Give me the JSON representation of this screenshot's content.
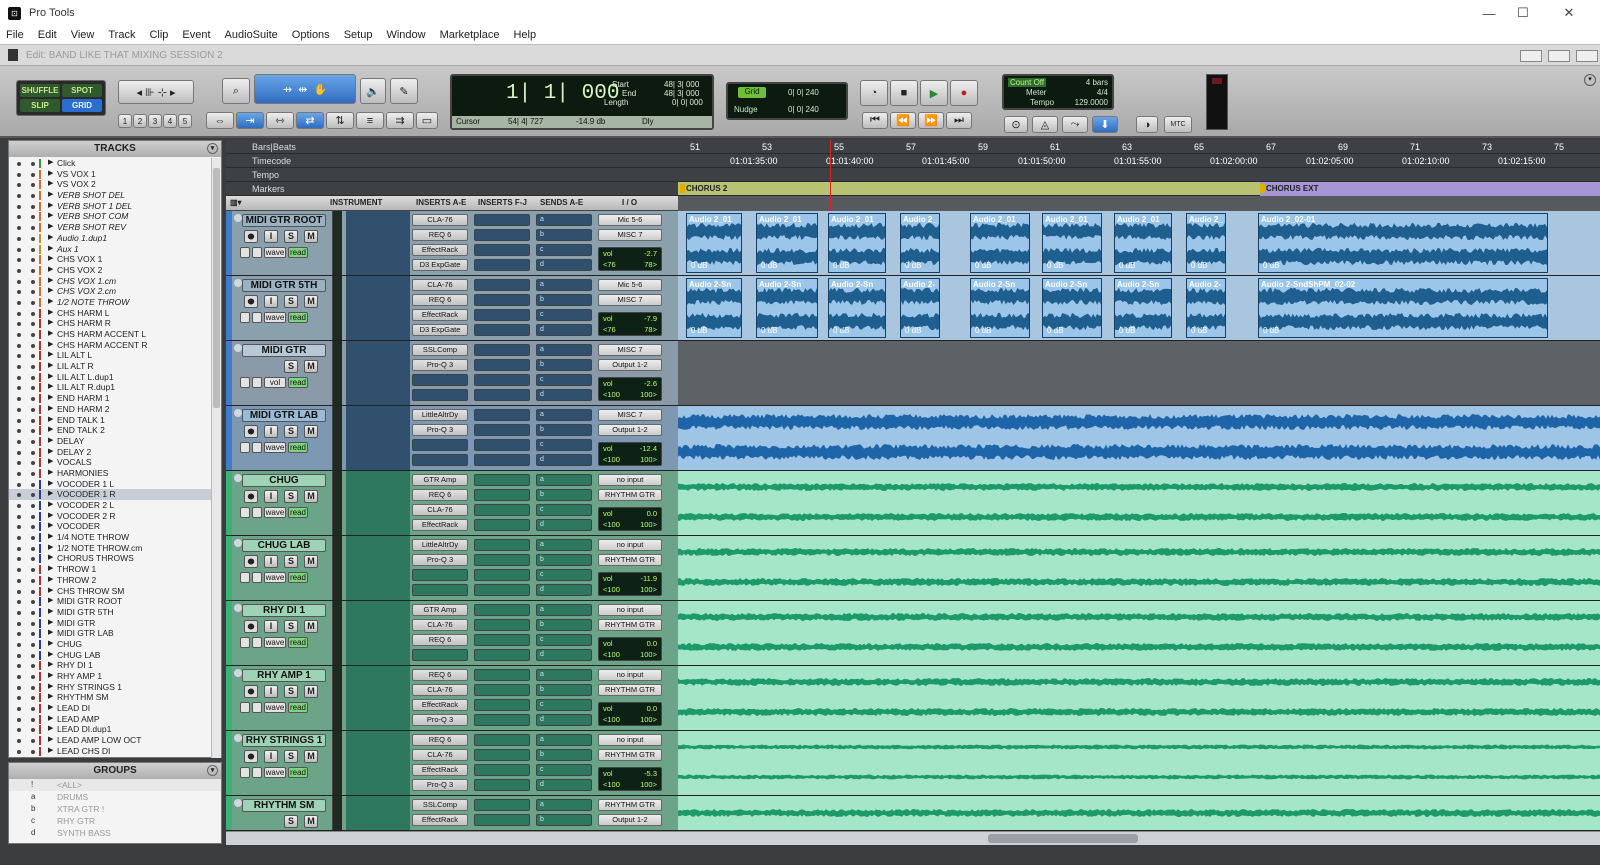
{
  "window": {
    "app_title": "Pro Tools",
    "controls": {
      "minimize": "—",
      "maximize": "☐",
      "close": "✕"
    }
  },
  "menu": [
    "File",
    "Edit",
    "View",
    "Track",
    "Clip",
    "Event",
    "AudioSuite",
    "Options",
    "Setup",
    "Window",
    "Marketplace",
    "Help"
  ],
  "edit_window": {
    "title": "Edit: BAND LIKE THAT MIXING SESSION 2"
  },
  "edit_modes": {
    "shuffle": "SHUFFLE",
    "spot": "SPOT",
    "slip": "SLIP",
    "grid": "GRID",
    "active": "GRID"
  },
  "zoom_presets": [
    "1",
    "2",
    "3",
    "4",
    "5"
  ],
  "counter": {
    "main": "1| 1| 000",
    "start_label": "Start",
    "start": "48| 3| 000",
    "end_label": "End",
    "end": "48| 3| 000",
    "length_label": "Length",
    "length": "0| 0| 000",
    "cursor_label": "Cursor",
    "cursor": "54| 4| 727",
    "cursor_db": "-14.9 db",
    "dly": "Dly"
  },
  "grid_nudge": {
    "grid_label": "Grid",
    "grid_value": "0| 0| 240",
    "nudge_label": "Nudge",
    "nudge_value": "0| 0| 240"
  },
  "midi_controls": {
    "count_off": "Count Off",
    "count_off_value": "4 bars",
    "meter_label": "Meter",
    "meter": "4/4",
    "tempo_label": "Tempo",
    "tempo": "129.0000",
    "mtc": "MTC"
  },
  "tracks_panel": {
    "title": "TRACKS",
    "selected": "VOCODER 1 R",
    "items": [
      {
        "name": "Click",
        "color": "#2d9b3a",
        "italic": false
      },
      {
        "name": "VS VOX 1",
        "color": "#d0702a",
        "italic": false
      },
      {
        "name": "VS VOX 2",
        "color": "#d0702a",
        "italic": false
      },
      {
        "name": "VERB SHOT DEL",
        "color": "#d0702a",
        "italic": true
      },
      {
        "name": "VERB SHOT 1 DEL",
        "color": "#d0702a",
        "italic": true
      },
      {
        "name": "VERB SHOT COM",
        "color": "#d0702a",
        "italic": true
      },
      {
        "name": "VERB SHOT REV",
        "color": "#d0702a",
        "italic": true
      },
      {
        "name": "Audio 1.dup1",
        "color": "#d0902a",
        "italic": true
      },
      {
        "name": "Aux 1",
        "color": "#d0902a",
        "italic": true
      },
      {
        "name": "CHS VOX 1",
        "color": "#d0702a",
        "italic": false
      },
      {
        "name": "CHS VOX 2",
        "color": "#d0702a",
        "italic": false
      },
      {
        "name": "CHS VOX 1.cm",
        "color": "#d0702a",
        "italic": true
      },
      {
        "name": "CHS VOX 2.cm",
        "color": "#d0702a",
        "italic": true
      },
      {
        "name": "1/2 NOTE THROW",
        "color": "#d0702a",
        "italic": true
      },
      {
        "name": "CHS HARM L",
        "color": "#b0342a",
        "italic": false
      },
      {
        "name": "CHS HARM R",
        "color": "#b0342a",
        "italic": false
      },
      {
        "name": "CHS HARM ACCENT L",
        "color": "#b0342a",
        "italic": false
      },
      {
        "name": "CHS HARM ACCENT R",
        "color": "#b0342a",
        "italic": false
      },
      {
        "name": "LIL ALT L",
        "color": "#b0342a",
        "italic": false
      },
      {
        "name": "LIL ALT R",
        "color": "#b0342a",
        "italic": false
      },
      {
        "name": "LIL ALT L.dup1",
        "color": "#b0342a",
        "italic": false
      },
      {
        "name": "LIL ALT R.dup1",
        "color": "#b0342a",
        "italic": false
      },
      {
        "name": "END HARM 1",
        "color": "#b0342a",
        "italic": false
      },
      {
        "name": "END HARM 2",
        "color": "#b0342a",
        "italic": false
      },
      {
        "name": "END TALK 1",
        "color": "#b0342a",
        "italic": false
      },
      {
        "name": "END TALK 2",
        "color": "#b0342a",
        "italic": false
      },
      {
        "name": "DELAY",
        "color": "#b0342a",
        "italic": false
      },
      {
        "name": "DELAY 2",
        "color": "#b0342a",
        "italic": false
      },
      {
        "name": "VOCALS",
        "color": "#b0342a",
        "italic": false
      },
      {
        "name": "HARMONIES",
        "color": "#b0342a",
        "italic": false
      },
      {
        "name": "VOCODER 1 L",
        "color": "#2a3aa0",
        "italic": false
      },
      {
        "name": "VOCODER 1 R",
        "color": "#2a3aa0",
        "italic": false
      },
      {
        "name": "VOCODER 2 L",
        "color": "#2a3aa0",
        "italic": false
      },
      {
        "name": "VOCODER 2 R",
        "color": "#2a3aa0",
        "italic": false
      },
      {
        "name": "VOCODER",
        "color": "#2a3aa0",
        "italic": false
      },
      {
        "name": "1/4 NOTE THROW",
        "color": "#2a3aa0",
        "italic": false
      },
      {
        "name": "1/2 NOTE THROW.cm",
        "color": "#2a3aa0",
        "italic": false
      },
      {
        "name": "CHORUS THROWS",
        "color": "#2a3aa0",
        "italic": false
      },
      {
        "name": "THROW 1",
        "color": "#b0342a",
        "italic": false
      },
      {
        "name": "THROW 2",
        "color": "#b0342a",
        "italic": false
      },
      {
        "name": "CHS THROW SM",
        "color": "#b0342a",
        "italic": false
      },
      {
        "name": "MIDI GTR ROOT",
        "color": "#2a3aa0",
        "italic": false
      },
      {
        "name": "MIDI GTR 5TH",
        "color": "#2a3aa0",
        "italic": false
      },
      {
        "name": "MIDI GTR",
        "color": "#2a3aa0",
        "italic": false
      },
      {
        "name": "MIDI GTR LAB",
        "color": "#2a3aa0",
        "italic": false
      },
      {
        "name": "CHUG",
        "color": "#2a3aa0",
        "italic": false
      },
      {
        "name": "CHUG LAB",
        "color": "#2a3aa0",
        "italic": false
      },
      {
        "name": "RHY DI 1",
        "color": "#b0342a",
        "italic": false
      },
      {
        "name": "RHY AMP 1",
        "color": "#b0342a",
        "italic": false
      },
      {
        "name": "RHY STRINGS 1",
        "color": "#b0342a",
        "italic": false
      },
      {
        "name": "RHYTHM SM",
        "color": "#b0342a",
        "italic": false
      },
      {
        "name": "LEAD DI",
        "color": "#b0342a",
        "italic": false
      },
      {
        "name": "LEAD AMP",
        "color": "#b0342a",
        "italic": false
      },
      {
        "name": "LEAD DI.dup1",
        "color": "#b0342a",
        "italic": false
      },
      {
        "name": "LEAD AMP LOW OCT",
        "color": "#b0342a",
        "italic": false
      },
      {
        "name": "LEAD CHS DI",
        "color": "#b0342a",
        "italic": false
      }
    ]
  },
  "groups_panel": {
    "title": "GROUPS",
    "items": [
      {
        "id": "!",
        "name": "<ALL>"
      },
      {
        "id": "a",
        "name": "DRUMS"
      },
      {
        "id": "b",
        "name": "XTRA GTR !"
      },
      {
        "id": "c",
        "name": "RHY GTR"
      },
      {
        "id": "d",
        "name": "SYNTH BASS"
      }
    ]
  },
  "rulers": {
    "bars_beats_label": "Bars|Beats",
    "timecode_label": "Timecode",
    "tempo_label": "Tempo",
    "markers_label": "Markers",
    "bars": [
      "51",
      "53",
      "55",
      "57",
      "59",
      "61",
      "63",
      "65",
      "67",
      "69",
      "71",
      "73",
      "75"
    ],
    "timecodes": [
      "01:01:35:00",
      "01:01:40:00",
      "01:01:45:00",
      "01:01:50:00",
      "01:01:55:00",
      "01:02:00:00",
      "01:02:05:00",
      "01:02:10:00",
      "01:02:15:00"
    ],
    "markers": [
      "CHORUS 2",
      "CHORUS EXT"
    ]
  },
  "columns": {
    "instrument": "INSTRUMENT",
    "inserts_ae": "INSERTS A-E",
    "inserts_fj": "INSERTS F-J",
    "sends_ae": "SENDS A-E",
    "io": "I / O"
  },
  "send_letters": [
    "a",
    "b",
    "c",
    "d"
  ],
  "track_buttons": {
    "rec": "",
    "input": "I",
    "solo": "S",
    "mute": "M",
    "wave": "wave",
    "read": "read",
    "vol": "vol"
  },
  "tracks": [
    {
      "name": "MIDI GTR ROOT",
      "kind": "midi-audio",
      "inserts": [
        "CLA-76",
        "REQ 6",
        "EffectRack",
        "D3 ExpGate"
      ],
      "io_in": "Mic 5-6",
      "io_out": "MISC 7",
      "vol": "-2.7",
      "pan_l": "<76",
      "pan_r": "78>",
      "clips": [
        "Audio 2_01",
        "Audio 2_01",
        "Audio 2_01",
        "Audio 2_",
        "Audio 2_01",
        "Audio 2_01",
        "Audio 2_01",
        "Audio 2_",
        "Audio 2_02-01"
      ],
      "gain": "0 dB"
    },
    {
      "name": "MIDI GTR 5TH",
      "kind": "midi-audio",
      "inserts": [
        "CLA-76",
        "REQ 6",
        "EffectRack",
        "D3 ExpGate"
      ],
      "io_in": "Mic 5-6",
      "io_out": "MISC 7",
      "vol": "-7.9",
      "pan_l": "<76",
      "pan_r": "78>",
      "clips": [
        "Audio 2-Sn",
        "Audio 2-Sn",
        "Audio 2-Sn",
        "Audio 2-",
        "Audio 2-Sn",
        "Audio 2-Sn",
        "Audio 2-Sn",
        "Audio 2-",
        "Audio 2-SndShPM_02-02"
      ],
      "gain": "0 dB"
    },
    {
      "name": "MIDI GTR",
      "kind": "empty",
      "inserts": [
        "SSLComp",
        "Pro-Q 3"
      ],
      "io_in": "MISC 7",
      "io_out": "Output 1-2",
      "vol": "-2.6",
      "pan_l": "<100",
      "pan_r": "100>"
    },
    {
      "name": "MIDI GTR LAB",
      "kind": "blue",
      "inserts": [
        "LittleAltrDy",
        "Pro-Q 3"
      ],
      "io_in": "MISC 7",
      "io_out": "Output 1-2",
      "vol": "-12.4",
      "pan_l": "<100",
      "pan_r": "100>"
    },
    {
      "name": "CHUG",
      "kind": "green",
      "inserts": [
        "GTR Amp",
        "REQ 6",
        "CLA-76",
        "EffectRack"
      ],
      "io_in": "no input",
      "io_out": "RHYTHM GTR",
      "vol": "0.0",
      "pan_l": "<100",
      "pan_r": "100>"
    },
    {
      "name": "CHUG LAB",
      "kind": "green",
      "inserts": [
        "LittleAltrDy",
        "Pro-Q 3"
      ],
      "io_in": "no input",
      "io_out": "RHYTHM GTR",
      "vol": "-11.9",
      "pan_l": "<100",
      "pan_r": "100>"
    },
    {
      "name": "RHY DI 1",
      "kind": "green",
      "inserts": [
        "GTR Amp",
        "CLA-76",
        "REQ 6"
      ],
      "io_in": "no input",
      "io_out": "RHYTHM GTR",
      "vol": "0.0",
      "pan_l": "<100",
      "pan_r": "100>"
    },
    {
      "name": "RHY AMP 1",
      "kind": "green",
      "inserts": [
        "REQ 6",
        "CLA-76",
        "EffectRack",
        "Pro-Q 3"
      ],
      "io_in": "no input",
      "io_out": "RHYTHM GTR",
      "vol": "0.0",
      "pan_l": "<100",
      "pan_r": "100>"
    },
    {
      "name": "RHY STRINGS 1",
      "kind": "green",
      "inserts": [
        "REQ 6",
        "CLA-76",
        "EffectRack",
        "Pro-Q 3"
      ],
      "io_in": "no input",
      "io_out": "RHYTHM GTR",
      "vol": "-5.3",
      "pan_l": "<100",
      "pan_r": "100>"
    },
    {
      "name": "RHYTHM SM",
      "kind": "aux",
      "inserts": [
        "SSLComp",
        "EffectRack"
      ],
      "io_in": "RHYTHM GTR",
      "io_out": "Output 1-2",
      "vol": "",
      "pan_l": "",
      "pan_r": ""
    }
  ]
}
